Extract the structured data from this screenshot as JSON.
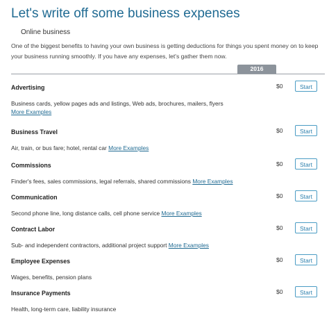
{
  "page": {
    "title": "Let's write off some business expenses",
    "subtitle": "Online business",
    "intro": "One of the biggest benefits to having your own business is getting deductions for things you spent money on to keep your business running smoothly. If you have any expenses, let's gather them now.",
    "year_tab": "2016"
  },
  "expenses": [
    {
      "title": "Advertising",
      "description": "Business cards, yellow pages ads and listings, Web ads, brochures, mailers, flyers",
      "link": "More Examples",
      "amount": "$0",
      "button": "Start"
    },
    {
      "title": "Business Travel",
      "description": "Air, train, or bus fare; hotel, rental car",
      "link": "More Examples",
      "amount": "$0",
      "button": "Start"
    },
    {
      "title": "Commissions",
      "description": "Finder's fees, sales commissions, legal referrals, shared commissions",
      "link": "More Examples",
      "amount": "$0",
      "button": "Start"
    },
    {
      "title": "Communication",
      "description": "Second phone line, long distance calls, cell phone service",
      "link": "More Examples",
      "amount": "$0",
      "button": "Start"
    },
    {
      "title": "Contract Labor",
      "description": "Sub- and independent contractors, additional project support",
      "link": "More Examples",
      "amount": "$0",
      "button": "Start"
    },
    {
      "title": "Employee Expenses",
      "description": "Wages, benefits, pension plans",
      "link": "",
      "amount": "$0",
      "button": "Start"
    },
    {
      "title": "Insurance Payments",
      "description": "Health, long-term care, liability insurance",
      "link": "",
      "amount": "$0",
      "button": "Start"
    }
  ]
}
